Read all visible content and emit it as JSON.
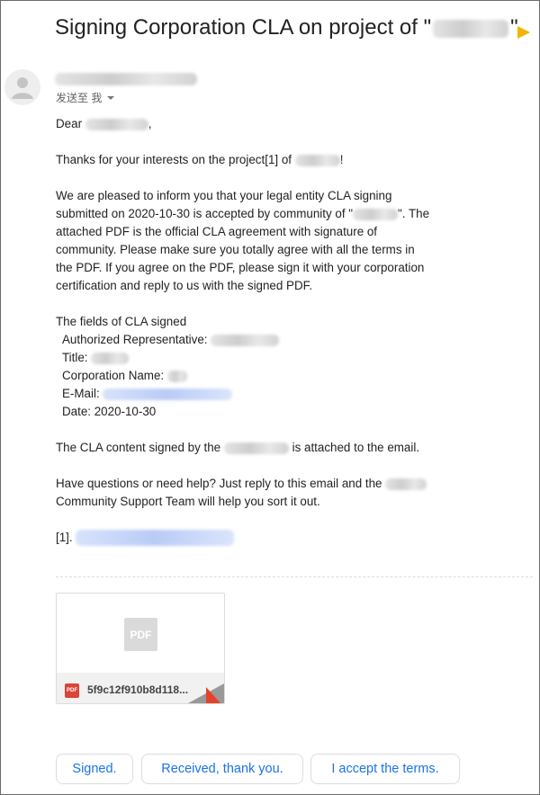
{
  "email": {
    "subject_prefix": "Signing Corporation CLA on project of \"",
    "subject_suffix": "\"",
    "recipient_label": "发送至 我",
    "greeting_prefix": "Dear",
    "greeting_suffix": ",",
    "line_thanks_prefix": "Thanks for your interests on the project[1] of",
    "line_thanks_suffix": "!",
    "para_inform_1": "We are pleased to inform you that your legal entity CLA signing",
    "para_inform_2a": "submitted on 2020-10-30 is accepted by community of \"",
    "para_inform_2b": "\". The",
    "para_inform_3": "attached PDF is the official CLA agreement with signature of",
    "para_inform_4": "community. Please make sure you totally agree with all the terms in",
    "para_inform_5": "the PDF. If you agree on the PDF, please sign it with your corporation",
    "para_inform_6": "certification and reply to us with the signed PDF.",
    "fields_heading": "The fields of CLA signed",
    "field_rep": "Authorized Representative:",
    "field_title": "Title:",
    "field_corp": "Corporation Name:",
    "field_email": "E-Mail:",
    "field_date": "Date: 2020-10-30",
    "cla_content_prefix": "The CLA content signed by the",
    "cla_content_suffix": "is attached to the email.",
    "help_line_1": "Have questions or need help? Just reply to this email and the",
    "help_line_2": "Community Support Team will help you sort it out.",
    "ref_prefix": "[1]."
  },
  "attachment": {
    "preview_label": "PDF",
    "type_badge": "PDF",
    "filename": "5f9c12f910b8d118..."
  },
  "smart_replies": [
    "Signed.",
    "Received, thank you.",
    "I accept the terms."
  ],
  "colors": {
    "label_arrow": "#f4b400",
    "reply_text": "#1a73e8",
    "pdf_badge": "#db4437"
  }
}
